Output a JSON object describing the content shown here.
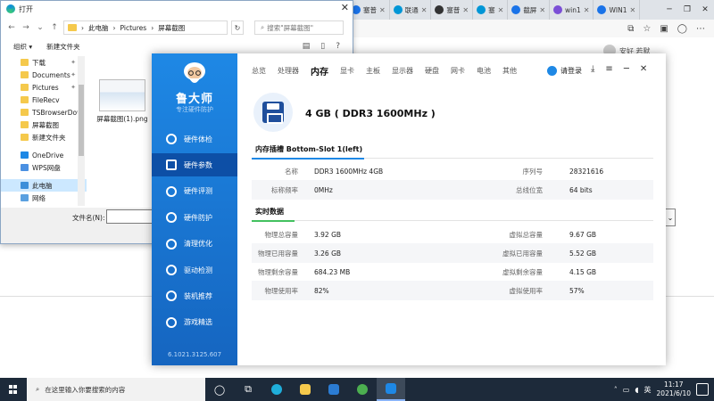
{
  "browser": {
    "tabs": [
      {
        "label": "塞普",
        "color": "#1a73e8"
      },
      {
        "label": "联通",
        "color": "#0096d6"
      },
      {
        "label": "塞普",
        "color": "#333333"
      },
      {
        "label": "塞",
        "color": "#0096d6"
      },
      {
        "label": "截屏",
        "color": "#1a73e8"
      },
      {
        "label": "win1",
        "color": "#7b4fd6"
      },
      {
        "label": "WIN1",
        "color": "#1a73e8"
      }
    ],
    "user_label": "安好 若默"
  },
  "dialog": {
    "title": "打开",
    "breadcrumb": [
      "此电脑",
      "Pictures",
      "屏幕截图"
    ],
    "search_placeholder": "搜索\"屏幕截图\"",
    "organize": "组织 ▾",
    "new_folder": "新建文件夹",
    "nav_items": [
      {
        "label": "下载",
        "pinned": true
      },
      {
        "label": "Documents",
        "pinned": true
      },
      {
        "label": "Pictures",
        "pinned": true
      },
      {
        "label": "FileRecv",
        "pinned": false
      },
      {
        "label": "TSBrowserDow",
        "pinned": false
      },
      {
        "label": "屏幕截图",
        "pinned": false
      },
      {
        "label": "新建文件夹",
        "pinned": false
      },
      {
        "label": "OneDrive",
        "pinned": false
      },
      {
        "label": "WPS网盘",
        "pinned": false
      },
      {
        "label": "此电脑",
        "pinned": false
      },
      {
        "label": "网络",
        "pinned": false
      }
    ],
    "file": {
      "name": "屏幕截图(1).png"
    },
    "filename_label": "文件名(N):"
  },
  "ludashi": {
    "brand": "鲁大师",
    "slogan": "专注硬件防护",
    "version": "6.1021.3125.607",
    "side_nav": [
      "硬件体检",
      "硬件参数",
      "硬件评测",
      "硬件防护",
      "清理优化",
      "驱动检测",
      "装机推荐",
      "游戏精选"
    ],
    "active_nav_index": 1,
    "tabs": [
      "总览",
      "处理器",
      "内存",
      "显卡",
      "主板",
      "显示器",
      "硬盘",
      "网卡",
      "电池",
      "其他"
    ],
    "active_tab_index": 2,
    "login_label": "请登录",
    "memory_title": "4 GB ( DDR3 1600MHz )",
    "slot_section": "内存插槽 Bottom-Slot 1(left)",
    "slot_rows": [
      {
        "k1": "名称",
        "v1": "DDR3 1600MHz 4GB",
        "k2": "序列号",
        "v2": "28321616"
      },
      {
        "k1": "标称频率",
        "v1": "0MHz",
        "k2": "总线位宽",
        "v2": "64 bits"
      }
    ],
    "realtime_section": "实时数据",
    "realtime_rows": [
      {
        "k1": "物理总容量",
        "v1": "3.92 GB",
        "k2": "虚拟总容量",
        "v2": "9.67 GB"
      },
      {
        "k1": "物理已用容量",
        "v1": "3.26 GB",
        "k2": "虚拟已用容量",
        "v2": "5.52 GB"
      },
      {
        "k1": "物理剩余容量",
        "v1": "684.23 MB",
        "k2": "虚拟剩余容量",
        "v2": "4.15 GB"
      },
      {
        "k1": "物理使用率",
        "v1": "82%",
        "k2": "虚拟使用率",
        "v2": "57%"
      }
    ],
    "colors": {
      "side_blue": "#1e88e5",
      "accent_blue": "#1e88e5",
      "accent_green": "#43c15f"
    }
  },
  "taskbar": {
    "search_placeholder": "在这里输入你要搜索的内容",
    "time": "11:17",
    "date": "2021/6/10",
    "ime": "英",
    "apps": [
      {
        "name": "edge-icon",
        "color": "#1faeda"
      },
      {
        "name": "folder-icon",
        "color": "#f5c94c"
      },
      {
        "name": "mail-icon",
        "color": "#2b7cd3"
      },
      {
        "name": "360-icon",
        "color": "#4caf50"
      },
      {
        "name": "ludashi-icon",
        "color": "#1e88e5"
      }
    ]
  }
}
